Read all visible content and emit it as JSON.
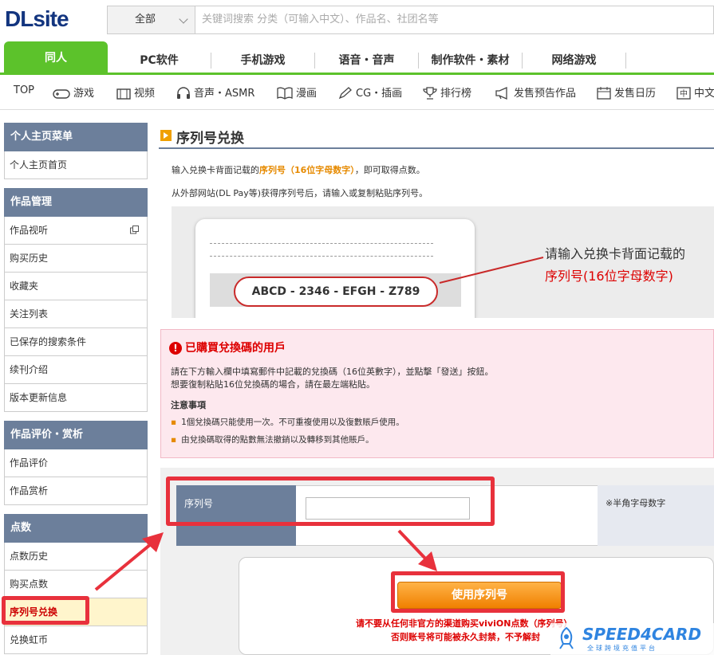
{
  "header": {
    "logo": "DLsite",
    "search_select": "全部",
    "search_placeholder": "关键词搜索 分类（可输入中文）、作品名、社团名等"
  },
  "categories": [
    "同人",
    "PC软件",
    "手机游戏",
    "语音・音声",
    "制作软件・素材",
    "网络游戏"
  ],
  "subnav": [
    "TOP",
    "游戏",
    "视频",
    "音声・ASMR",
    "漫画",
    "CG・插画",
    "排行榜",
    "发售预告作品",
    "发售日历",
    "中文"
  ],
  "sidebar": [
    {
      "title": "个人主页菜单",
      "items": [
        "个人主页首页"
      ]
    },
    {
      "title": "作品管理",
      "items": [
        "作品视听",
        "购买历史",
        "收藏夹",
        "关注列表",
        "已保存的搜索条件",
        "续刊介绍",
        "版本更新信息"
      ]
    },
    {
      "title": "作品评价・赏析",
      "items": [
        "作品评价",
        "作品赏析"
      ]
    },
    {
      "title": "点数",
      "items": [
        "点数历史",
        "购买点数",
        "序列号兑换",
        "兑换虹币"
      ]
    }
  ],
  "main": {
    "title": "序列号兑换",
    "intro_a": "输入兑换卡背面记载的",
    "intro_b": "序列号（16位字母数字）",
    "intro_c": "，即可取得点数。",
    "intro2": "从外部网站(DL Pay等)获得序列号后，请输入或复制粘贴序列号。",
    "sample_code": "ABCD - 2346 - EFGH - Z789",
    "note_line1": "请输入兑换卡背面记载的",
    "note_line2": "序列号(16位字母数字)"
  },
  "warning": {
    "title": "已購買兌換碼的用戶",
    "line1": "請在下方輸入欄中填寫郵件中記載的兌換碼（16位英數字），並點擊「發送」按鈕。",
    "line2": "想要復制粘貼16位兌換碼的場合，請在最左端粘貼。",
    "subtitle": "注意事項",
    "bullets": [
      "1個兌換碼只能使用一次。不可重複使用以及復數賬戶使用。",
      "由兌換碼取得的點數無法撤銷以及轉移到其他賬戶。"
    ]
  },
  "form": {
    "label": "序列号",
    "hint": "※半角字母数字",
    "button": "使用序列号",
    "notice1": "请不要从任何非官方的渠道购买viviON点数（序列号）",
    "notice2": "否则账号将可能被永久封禁，不予解封"
  },
  "watermark": {
    "brand": "SPEED4CARD",
    "tagline": "全球跨境充值平台"
  },
  "colors": {
    "accent_green": "#5cc22b",
    "sidebar_header": "#6c7f9b",
    "highlight_red": "#e8313c",
    "button_orange": "#f08000"
  }
}
